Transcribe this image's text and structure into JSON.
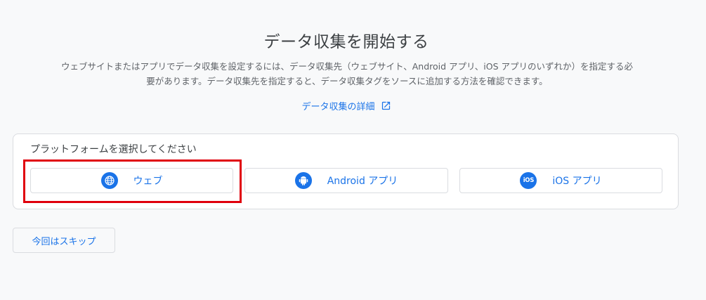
{
  "heading": "データ収集を開始する",
  "description": "ウェブサイトまたはアプリでデータ収集を設定するには、データ収集先（ウェブサイト、Android アプリ、iOS アプリのいずれか）を指定する必要があります。データ収集先を指定すると、データ収集タグをソースに追加する方法を確認できます。",
  "learn_more": {
    "label": "データ収集の詳細",
    "icon": "external-link-icon"
  },
  "platform_selector": {
    "label": "プラットフォームを選択してください",
    "options": [
      {
        "label": "ウェブ",
        "icon": "globe-icon"
      },
      {
        "label": "Android アプリ",
        "icon": "android-icon"
      },
      {
        "label": "iOS アプリ",
        "icon": "ios-icon",
        "icon_text": "iOS"
      }
    ]
  },
  "skip_button": {
    "label": "今回はスキップ"
  },
  "colors": {
    "accent": "#1a73e8",
    "highlight": "#e0000c",
    "background": "#f8f9fa"
  }
}
